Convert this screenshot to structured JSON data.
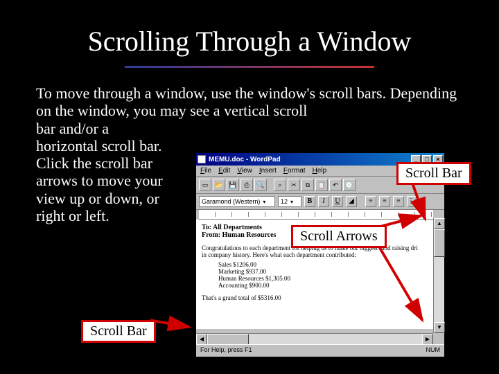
{
  "title": "Scrolling Through a Window",
  "body": {
    "line1": "To move through a window, use the window's scroll bars.",
    "line2": "Depending on the window, you may see a vertical scroll",
    "line3": "bar and/or a",
    "line4": "horizontal scroll bar.",
    "line5": "Click the scroll bar",
    "line6": "arrows to move your",
    "line7": "view up or down, or",
    "line8": "right or left."
  },
  "callouts": {
    "scrollbar_right": "Scroll Bar",
    "scroll_arrows": "Scroll Arrows",
    "scrollbar_bottom": "Scroll Bar"
  },
  "wordpad": {
    "title": "MEMU.doc - WordPad",
    "menu": [
      "File",
      "Edit",
      "View",
      "Insert",
      "Format",
      "Help"
    ],
    "font_name": "Garamond (Western)",
    "font_size": "12",
    "format_buttons": [
      "B",
      "I",
      "U"
    ],
    "doc": {
      "to": "To: All Departments",
      "from": "From: Human Resources",
      "p1": "Congratulations to each department for helping us to make our biggest fund raising dri",
      "p2": "in company history. Here's what each department contributed:",
      "rows": [
        "Sales $1206.00",
        "Marketing $937.00",
        "Human Resources $1,305.00",
        "Accounting $900.00"
      ],
      "total": "That's a grand total of $5316.00"
    },
    "status_left": "For Help, press F1",
    "status_right": "NUM"
  }
}
